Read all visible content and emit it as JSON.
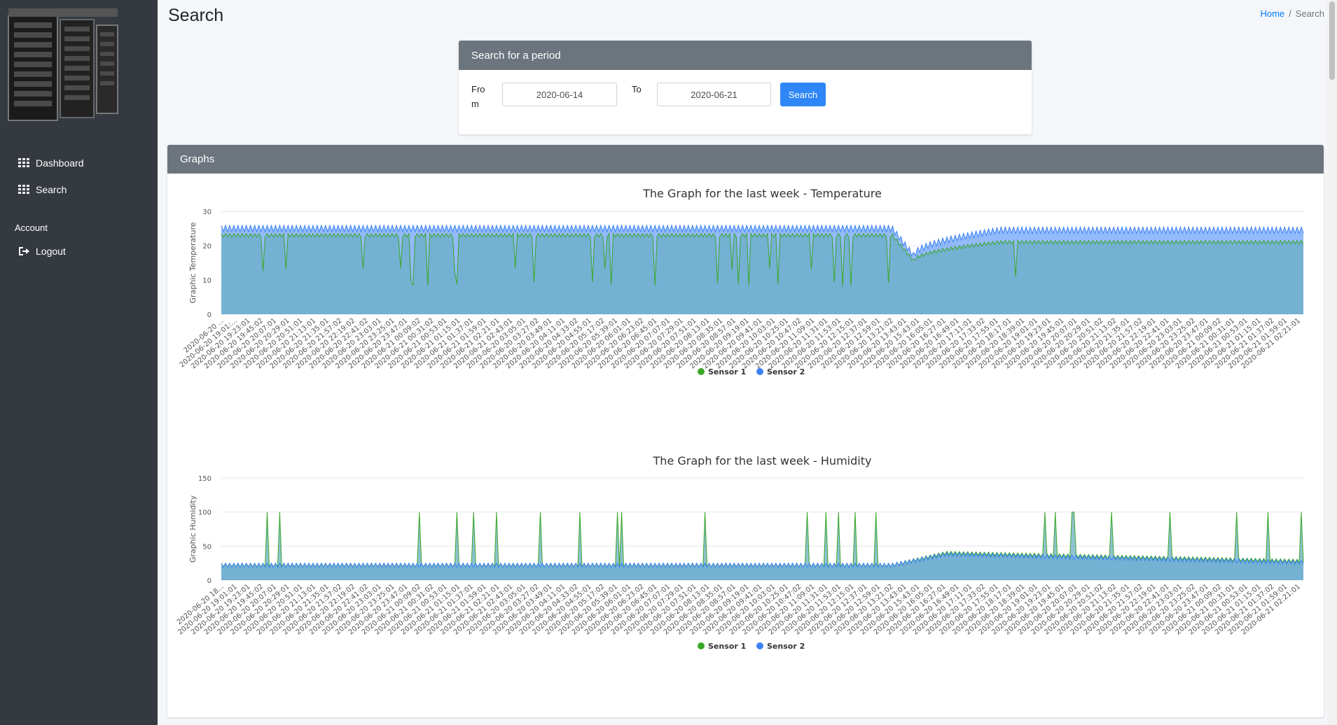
{
  "sidebar": {
    "items": [
      {
        "label": "Dashboard",
        "icon": "grid-icon"
      },
      {
        "label": "Search",
        "icon": "grid-icon"
      }
    ],
    "account_header": "Account",
    "logout": {
      "label": "Logout",
      "icon": "sign-out-icon"
    }
  },
  "header": {
    "title": "Search",
    "breadcrumb": {
      "home": "Home",
      "separator": "/",
      "current": "Search"
    }
  },
  "search_card": {
    "title": "Search for a period",
    "from_label": "Fro\nm",
    "from_value": "2020-06-14",
    "to_label": "To",
    "to_value": "2020-06-21",
    "button": "Search"
  },
  "graphs_card": {
    "title": "Graphs"
  },
  "colors": {
    "sensor1": "#3aa728",
    "sensor2": "#3b82f6",
    "area_fill": "#6aaec4",
    "sidebar": "#343a40",
    "card_header": "#6c757d",
    "accent": "#007bff"
  },
  "chart_data": [
    {
      "type": "area",
      "title": "The Graph for the last week - Temperature",
      "ylabel": "Graphic Temperature",
      "xlabel": "",
      "ylim": [
        0,
        30
      ],
      "yticks": [
        0,
        10,
        20,
        30
      ],
      "legend": "bottom-center",
      "series": [
        {
          "name": "Sensor 1",
          "color": "#3aa728",
          "baseline": 23,
          "drop_to": 15.5,
          "recover_to": 21,
          "dips": [
            8,
            12
          ]
        },
        {
          "name": "Sensor 2",
          "color": "#3b82f6",
          "baseline": 25,
          "drop_to": 17,
          "recover_to": 24.5
        }
      ],
      "x_tick_labels": [
        "2020-06-20 ...",
        "2020-06-20 19:01:...",
        "2020-06-20 19:23:01",
        "2020-06-20 19:45:02",
        "2020-06-20 20:07:01",
        "2020-06-20 20:29:01",
        "2020-06-20 20:51:01",
        "2020-06-20 21:13:01",
        "2020-06-20 21:35:01",
        "2020-06-20 21:57:02",
        "2020-06-20 22:19:02",
        "2020-06-20 22:41:02",
        "2020-06-20 23:03:01",
        "2020-06-20 23:25:01",
        "2020-06-20 23:47:01",
        "2020-06-21 00:09:02",
        "2020-06-21 00:31:02",
        "2020-06-21 00:53:01",
        "2020-06-21 01:15:01",
        "2020-06-21 01:37:01",
        "2020-06-21 01:59:01",
        "2020-06-21 02:21:01",
        "2020-06-21 02:43:01",
        "2020-06-20 03:05:01",
        "2020-06-20 03:27:02",
        "2020-06-20 03:49:01",
        "2020-06-20 04:11:01",
        "2020-06-20 04:33:02",
        "2020-06-20 04:55:01",
        "2020-06-20 05:17:02",
        "2020-06-20 05:39:01",
        "2020-06-20 06:01:01",
        "2020-06-20 06:23:02",
        "2020-06-20 06:45:01",
        "2020-06-20 07:07:01",
        "2020-06-20 07:29:01",
        "2020-06-20 07:51:01",
        "2020-06-20 08:13:01",
        "2020-06-20 08:35:01",
        "2020-06-20 08:57:01",
        "2020-06-20 09:19:01",
        "2020-06-20 09:41:01",
        "2020-06-20 10:03:01",
        "2020-06-20 10:25:01",
        "2020-06-20 10:47:02",
        "2020-06-20 11:09:01",
        "2020-06-20 11:31:01",
        "2020-06-20 11:53:01",
        "2020-06-20 12:15:01",
        "2020-06-20 12:37:01",
        "2020-06-20 12:59:01",
        "2020-06-20 13:21:02",
        "2020-06-20 13:43:01",
        "2020-06-20 15:43:01",
        "2020-06-20 16:05:01",
        "2020-06-20 16:27:01",
        "2020-06-20 16:49:01",
        "2020-06-20 17:11:01",
        "2020-06-20 17:33:02",
        "2020-06-20 17:55:01",
        "2020-06-20 18:17:01",
        "2020-06-20 18:39:01",
        "2020-06-20 19:01:01",
        "2020-06-20 19:23:01",
        "2020-06-20 19:45:01",
        "2020-06-20 20:07:01",
        "2020-06-20 20:29:01",
        "2020-06-20 20:51:02",
        "2020-06-20 21:13:02",
        "2020-06-20 21:35:01",
        "2020-06-20 21:57:02",
        "2020-06-20 22:19:01",
        "2020-06-20 22:41:01",
        "2020-06-20 23:03:01",
        "2020-06-20 23:25:02",
        "2020-06-20 23:47:01",
        "2020-06-21 00:09:02",
        "2020-06-21 00:31:01",
        "2020-06-21 00:53:01",
        "2020-06-21 01:15:01",
        "2020-06-21 01:37:02",
        "2020-06-21 01:59:01",
        "2020-06-21 02:21:01"
      ]
    },
    {
      "type": "area",
      "title": "The Graph for the last week - Humidity",
      "ylabel": "Graphic Humidity",
      "xlabel": "",
      "ylim": [
        0,
        150
      ],
      "yticks": [
        0,
        50,
        100,
        150
      ],
      "legend": "bottom-center",
      "series": [
        {
          "name": "Sensor 1",
          "color": "#3aa728",
          "baseline": 22,
          "rise_to": 40,
          "settle_to": 28,
          "spikes": [
            100
          ]
        },
        {
          "name": "Sensor 2",
          "color": "#3b82f6",
          "baseline": 22,
          "rise_to": 38,
          "settle_to": 26
        }
      ],
      "x_tick_labels": [
        "2020-06-20 18...",
        "2020-06-20 19:01:01",
        "2020-06-20 19:23:01",
        "2020-06-20 19:45:02",
        "2020-06-20 20:07:01",
        "2020-06-20 20:29:01",
        "2020-06-20 20:51:01",
        "2020-06-20 21:13:01",
        "2020-06-20 21:35:01",
        "2020-06-20 21:57:02",
        "2020-06-20 22:19:02",
        "2020-06-20 22:41:02",
        "2020-06-20 23:03:01",
        "2020-06-20 23:25:01",
        "2020-06-20 23:47:01",
        "2020-06-21 00:09:02",
        "2020-06-21 00:31:02",
        "2020-06-21 00:53:01",
        "2020-06-21 01:15:01",
        "2020-06-21 01:37:01",
        "2020-06-21 01:59:01",
        "2020-06-21 02:21:01",
        "2020-06-21 02:43:01",
        "2020-06-20 03:05:01",
        "2020-06-20 03:27:02",
        "2020-06-20 03:49:01",
        "2020-06-20 04:11:01",
        "2020-06-20 04:33:02",
        "2020-06-20 04:55:01",
        "2020-06-20 05:17:02",
        "2020-06-20 05:39:01",
        "2020-06-20 06:01:01",
        "2020-06-20 06:23:02",
        "2020-06-20 06:45:01",
        "2020-06-20 07:07:01",
        "2020-06-20 07:29:01",
        "2020-06-20 07:51:01",
        "2020-06-20 08:13:01",
        "2020-06-20 08:35:01",
        "2020-06-20 08:57:01",
        "2020-06-20 09:19:01",
        "2020-06-20 09:41:01",
        "2020-06-20 10:03:01",
        "2020-06-20 10:25:01",
        "2020-06-20 10:47:02",
        "2020-06-20 11:09:01",
        "2020-06-20 11:31:01",
        "2020-06-20 11:53:01",
        "2020-06-20 12:15:01",
        "2020-06-20 12:37:01",
        "2020-06-20 12:59:01",
        "2020-06-20 13:21:02",
        "2020-06-20 13:43:01",
        "2020-06-20 15:43:01",
        "2020-06-20 16:05:01",
        "2020-06-20 16:27:01",
        "2020-06-20 16:49:01",
        "2020-06-20 17:11:01",
        "2020-06-20 17:33:02",
        "2020-06-20 17:55:01",
        "2020-06-20 18:17:01",
        "2020-06-20 18:39:01",
        "2020-06-20 19:01:01",
        "2020-06-20 19:23:01",
        "2020-06-20 19:45:01",
        "2020-06-20 20:07:01",
        "2020-06-20 20:29:01",
        "2020-06-20 20:51:02",
        "2020-06-20 21:13:02",
        "2020-06-20 21:35:01",
        "2020-06-20 21:57:02",
        "2020-06-20 22:19:01",
        "2020-06-20 22:41:01",
        "2020-06-20 23:03:01",
        "2020-06-20 23:25:02",
        "2020-06-20 23:47:01",
        "2020-06-21 00:09:02",
        "2020-06-21 00:31:01",
        "2020-06-21 00:53:01",
        "2020-06-21 01:15:01",
        "2020-06-21 01:37:02",
        "2020-06-21 01:59:01",
        "2020-06-21 02:21:01"
      ]
    }
  ]
}
